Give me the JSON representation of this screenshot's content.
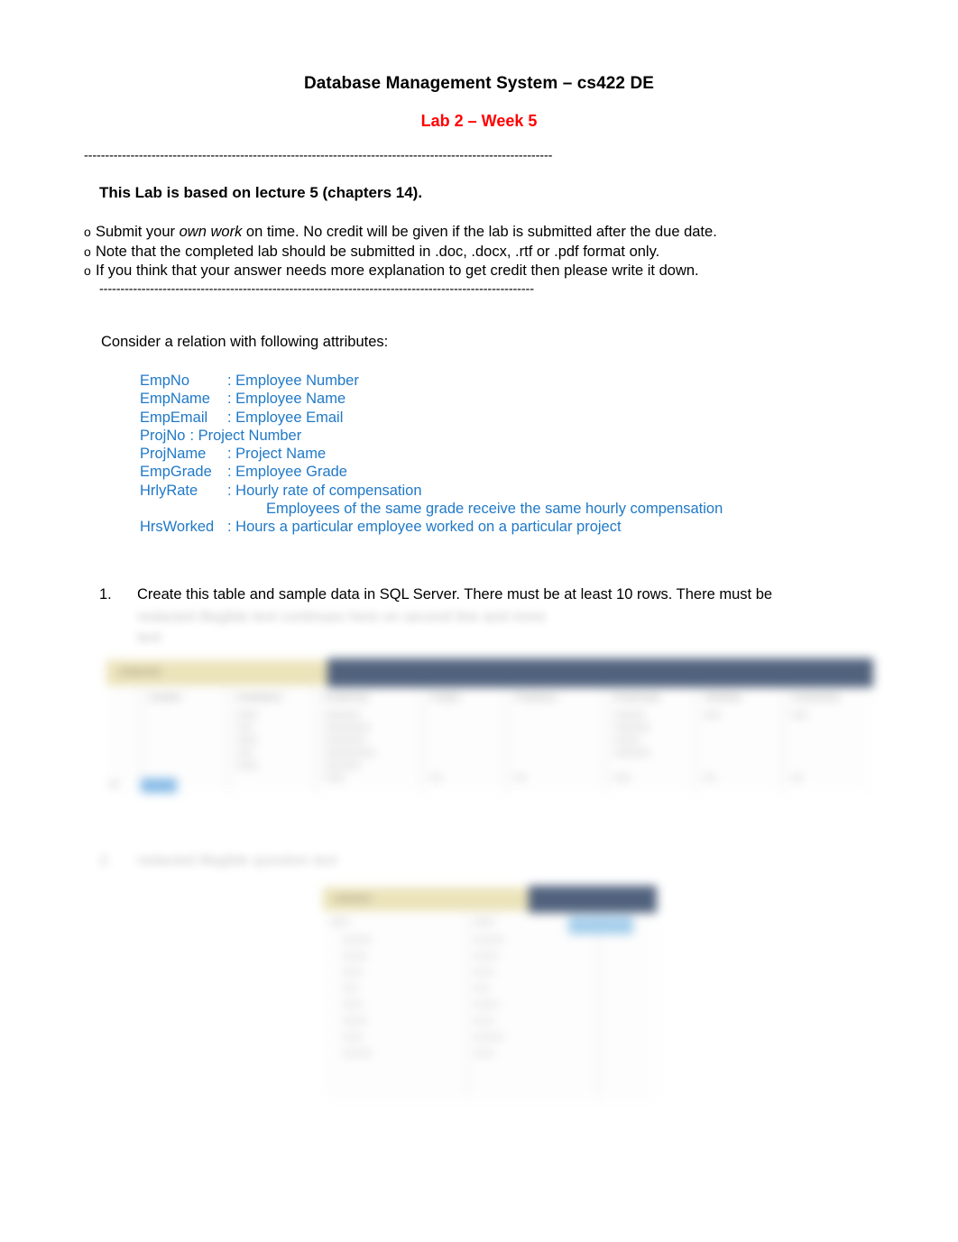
{
  "document": {
    "title": "Database Management System – cs422 DE",
    "subtitle": "Lab 2 – Week 5",
    "rule_top": "---------------------------------------------------------------------------------------------------------------",
    "rule_mid": "-------------------------------------------------------------------------------------------------------",
    "lab_note": "This Lab is based on lecture 5 (chapters 14).",
    "bullets": [
      {
        "marker": "o",
        "pre": "Submit your ",
        "em": "own work",
        "post": " on time. No credit will be given if the lab is submitted after the due date."
      },
      {
        "marker": "o",
        "pre": "Note that the completed lab should be submitted in .doc, .docx, .rtf or .pdf format only.",
        "em": "",
        "post": ""
      },
      {
        "marker": "o",
        "pre": "If you think that your answer needs more explanation to get credit then please write it down.",
        "em": "",
        "post": ""
      }
    ],
    "consider_line": "Consider a relation with following attributes:",
    "attributes": [
      {
        "name": "EmpNo",
        "desc": ": Employee Number"
      },
      {
        "name": "EmpName",
        "desc": ": Employee Name"
      },
      {
        "name": "EmpEmail",
        "desc": ": Employee Email"
      },
      {
        "name": "ProjNo",
        "desc": ": Project Number",
        "inline": true
      },
      {
        "name": "ProjName",
        "desc": ": Project Name"
      },
      {
        "name": "EmpGrade",
        "desc": ": Employee Grade"
      },
      {
        "name": "HrlyRate",
        "desc": ": Hourly rate of compensation"
      },
      {
        "name": "HrsWorked",
        "desc": ": Hours a particular employee worked on a particular project"
      }
    ],
    "attr_continuation": "Employees of the same grade receive the same hourly compensation",
    "questions": [
      {
        "marker": "1.",
        "text": "Create this table and sample data in SQL Server. There must be at least 10 rows. There must be",
        "blurred_line_2": "redacted illegible text continues here on second line and more",
        "blurred_line_3": "text"
      },
      {
        "marker": "2.",
        "text": "redacted illegible question text"
      }
    ],
    "colors": {
      "title": "#000000",
      "subtitle_red": "#ff0000",
      "attribute_blue": "#2079c7",
      "grid_tab_yellow": "#e9e0b2",
      "grid_header_navy": "#3f5270",
      "grid_selection_blue": "#7ab4e4",
      "page_background": "#ffffff"
    }
  },
  "screenshots": [
    {
      "name": "sql-server-results-grid-1",
      "tab_label": "redacted",
      "column_headers": [
        "EmpNo",
        "EmpName",
        "EmpEmail",
        "ProjNo",
        "ProjName",
        "EmpGrade",
        "HrlyRate",
        "HrsWorked"
      ],
      "rows": 10,
      "selected_cell": "EmpNo"
    },
    {
      "name": "sql-server-results-grid-2",
      "tab_label": "redacted",
      "column_headers": [
        "col-1",
        "col-2",
        "col-3"
      ],
      "rows": 10,
      "selected_cell": "col-3-header"
    }
  ]
}
